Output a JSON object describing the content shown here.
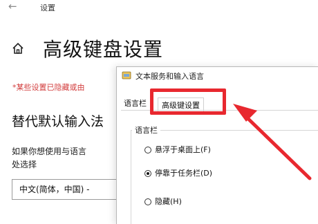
{
  "settings": {
    "back_glyph": "←",
    "window_title": "设置",
    "page_title": "高级键盘设置",
    "warning": "*某些设置已隐藏或由",
    "section_heading": "替代默认输入法",
    "description_line1": "如果你想使用与语言",
    "description_line2": "处选择",
    "language_select_value": "中文(简体，中国) -"
  },
  "dialog": {
    "title": "文本服务和输入语言",
    "tabs": [
      {
        "label": "语言栏"
      },
      {
        "label": "高级键设置"
      }
    ],
    "group_label": "语言栏",
    "radio_options": [
      {
        "label": "悬浮于桌面上(F)",
        "checked": false
      },
      {
        "label": "停靠于任务栏(D)",
        "checked": true
      },
      {
        "label": "隐藏(H)",
        "checked": false
      }
    ]
  },
  "annotation": {
    "color": "#e8282f"
  },
  "colors": {
    "warning": "#d23c3c",
    "title_text": "#111111"
  }
}
